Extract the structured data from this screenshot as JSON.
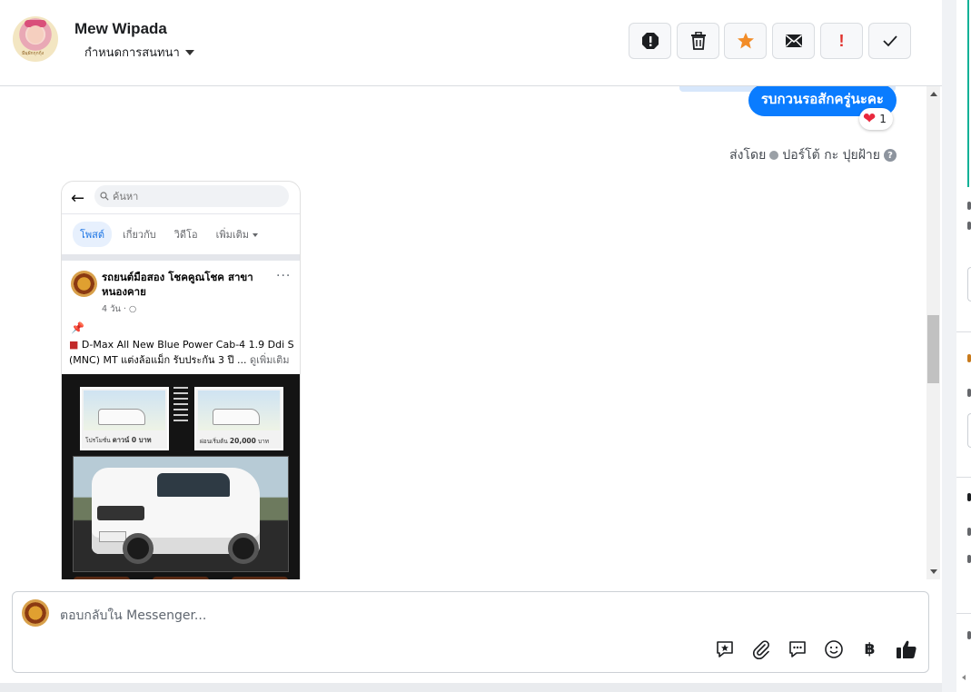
{
  "header": {
    "customer_name": "Mew Wipada",
    "assign_label": "กำหนดการสนทนา",
    "avatar_caption": "มีมฺผักกุกกุ้ง",
    "toolbar": {
      "spam": "spam-icon",
      "delete": "trash-icon",
      "star": "star-icon",
      "mail": "mail-icon",
      "important": "!",
      "done": "check-icon"
    }
  },
  "chat": {
    "last_message": "รบกวนรอสักครู่นะคะ",
    "reaction": {
      "emoji": "❤",
      "count": "1"
    },
    "sent_by_prefix": "ส่งโดย",
    "sent_by_name": "ปอร์โต้ กะ ปุยฝ้าย",
    "help_icon": "?"
  },
  "shared_post": {
    "search_placeholder": "ค้นหา",
    "tabs": [
      "โพสต์",
      "เกี่ยวกับ",
      "วิดีโอ",
      "เพิ่มเติม"
    ],
    "page_name": "รถยนต์มือสอง โชคคูณโชค สาขาหนองคาย",
    "time": "4 วัน · ",
    "more": "···",
    "text_line1": "D-Max All New Blue Power Cab-4 1.9 Ddi S",
    "text_line2": "(MNC) MT แต่งล้อแม็ก รับประกัน 3 ปี ... ",
    "see_more": "ดูเพิ่มเติม",
    "card1_label": "ดาวน์ 0 บาท",
    "card1_small": "โปรโมชั่น",
    "card2_label": "20,000",
    "card2_small": "ผ่อนเริ่มต้น",
    "card2_unit": "บาท"
  },
  "composer": {
    "placeholder": "ตอบกลับใน Messenger...",
    "icons": [
      "saved-reply-icon",
      "attachment-icon",
      "quick-reply-icon",
      "emoji-icon",
      "payment-icon",
      "like-icon"
    ],
    "baht_symbol": "฿"
  },
  "colors": {
    "messenger_blue": "#0a7cff",
    "heart": "#e8283d",
    "star": "#f28c28",
    "important": "#e0302b",
    "teal": "#0bb197"
  }
}
